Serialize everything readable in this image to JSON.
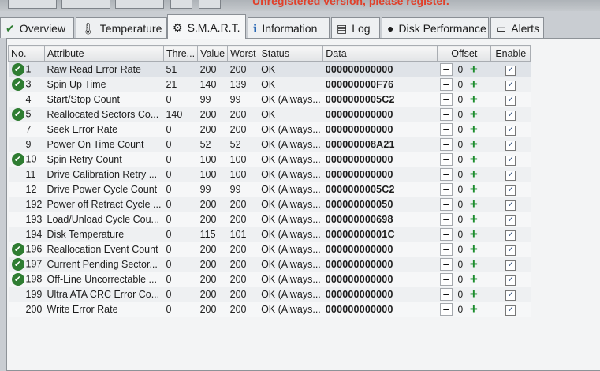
{
  "banner": {
    "text": "Unregistered version, please register."
  },
  "tabs": [
    {
      "label": "Overview",
      "icon": "check-circle-icon",
      "active": false
    },
    {
      "label": "Temperature",
      "icon": "thermometer-icon",
      "active": false
    },
    {
      "label": "S.M.A.R.T.",
      "icon": "smart-wrench-icon",
      "active": true
    },
    {
      "label": "Information",
      "icon": "info-icon",
      "active": false
    },
    {
      "label": "Log",
      "icon": "log-icon",
      "active": false
    },
    {
      "label": "Disk Performance",
      "icon": "performance-disk-icon",
      "active": false
    },
    {
      "label": "Alerts",
      "icon": "alerts-icon",
      "active": false
    }
  ],
  "table": {
    "headers": [
      "No.",
      "Attribute",
      "Thre...",
      "Value",
      "Worst",
      "Status",
      "Data",
      "Offset",
      "Enable"
    ],
    "rows": [
      {
        "no": "1",
        "ok": true,
        "attribute": "Raw Read Error Rate",
        "threshold": "51",
        "value": "200",
        "worst": "200",
        "status": "OK",
        "data": "000000000000",
        "offset": "0",
        "enabled": true
      },
      {
        "no": "3",
        "ok": true,
        "attribute": "Spin Up Time",
        "threshold": "21",
        "value": "140",
        "worst": "139",
        "status": "OK",
        "data": "000000000F76",
        "offset": "0",
        "enabled": true
      },
      {
        "no": "4",
        "ok": false,
        "attribute": "Start/Stop Count",
        "threshold": "0",
        "value": "99",
        "worst": "99",
        "status": "OK (Always...",
        "data": "0000000005C2",
        "offset": "0",
        "enabled": true
      },
      {
        "no": "5",
        "ok": true,
        "attribute": "Reallocated Sectors Co...",
        "threshold": "140",
        "value": "200",
        "worst": "200",
        "status": "OK",
        "data": "000000000000",
        "offset": "0",
        "enabled": true
      },
      {
        "no": "7",
        "ok": false,
        "attribute": "Seek Error Rate",
        "threshold": "0",
        "value": "200",
        "worst": "200",
        "status": "OK (Always...",
        "data": "000000000000",
        "offset": "0",
        "enabled": true
      },
      {
        "no": "9",
        "ok": false,
        "attribute": "Power On Time Count",
        "threshold": "0",
        "value": "52",
        "worst": "52",
        "status": "OK (Always...",
        "data": "000000008A21",
        "offset": "0",
        "enabled": true
      },
      {
        "no": "10",
        "ok": true,
        "attribute": "Spin Retry Count",
        "threshold": "0",
        "value": "100",
        "worst": "100",
        "status": "OK (Always...",
        "data": "000000000000",
        "offset": "0",
        "enabled": true
      },
      {
        "no": "11",
        "ok": false,
        "attribute": "Drive Calibration Retry ...",
        "threshold": "0",
        "value": "100",
        "worst": "100",
        "status": "OK (Always...",
        "data": "000000000000",
        "offset": "0",
        "enabled": true
      },
      {
        "no": "12",
        "ok": false,
        "attribute": "Drive Power Cycle Count",
        "threshold": "0",
        "value": "99",
        "worst": "99",
        "status": "OK (Always...",
        "data": "0000000005C2",
        "offset": "0",
        "enabled": true
      },
      {
        "no": "192",
        "ok": false,
        "attribute": "Power off Retract Cycle ...",
        "threshold": "0",
        "value": "200",
        "worst": "200",
        "status": "OK (Always...",
        "data": "000000000050",
        "offset": "0",
        "enabled": true
      },
      {
        "no": "193",
        "ok": false,
        "attribute": "Load/Unload Cycle Cou...",
        "threshold": "0",
        "value": "200",
        "worst": "200",
        "status": "OK (Always...",
        "data": "000000000698",
        "offset": "0",
        "enabled": true
      },
      {
        "no": "194",
        "ok": false,
        "attribute": "Disk Temperature",
        "threshold": "0",
        "value": "115",
        "worst": "101",
        "status": "OK (Always...",
        "data": "00000000001C",
        "offset": "0",
        "enabled": true
      },
      {
        "no": "196",
        "ok": true,
        "attribute": "Reallocation Event Count",
        "threshold": "0",
        "value": "200",
        "worst": "200",
        "status": "OK (Always...",
        "data": "000000000000",
        "offset": "0",
        "enabled": true
      },
      {
        "no": "197",
        "ok": true,
        "attribute": "Current Pending Sector...",
        "threshold": "0",
        "value": "200",
        "worst": "200",
        "status": "OK (Always...",
        "data": "000000000000",
        "offset": "0",
        "enabled": true
      },
      {
        "no": "198",
        "ok": true,
        "attribute": "Off-Line Uncorrectable ...",
        "threshold": "0",
        "value": "200",
        "worst": "200",
        "status": "OK (Always...",
        "data": "000000000000",
        "offset": "0",
        "enabled": true
      },
      {
        "no": "199",
        "ok": false,
        "attribute": "Ultra ATA CRC Error Co...",
        "threshold": "0",
        "value": "200",
        "worst": "200",
        "status": "OK (Always...",
        "data": "000000000000",
        "offset": "0",
        "enabled": true
      },
      {
        "no": "200",
        "ok": false,
        "attribute": "Write Error Rate",
        "threshold": "0",
        "value": "200",
        "worst": "200",
        "status": "OK (Always...",
        "data": "000000000000",
        "offset": "0",
        "enabled": true
      }
    ]
  },
  "colors": {
    "ok_green": "#2f7d32",
    "plus_green": "#1b8c2c",
    "banner_red": "#e0402a"
  }
}
